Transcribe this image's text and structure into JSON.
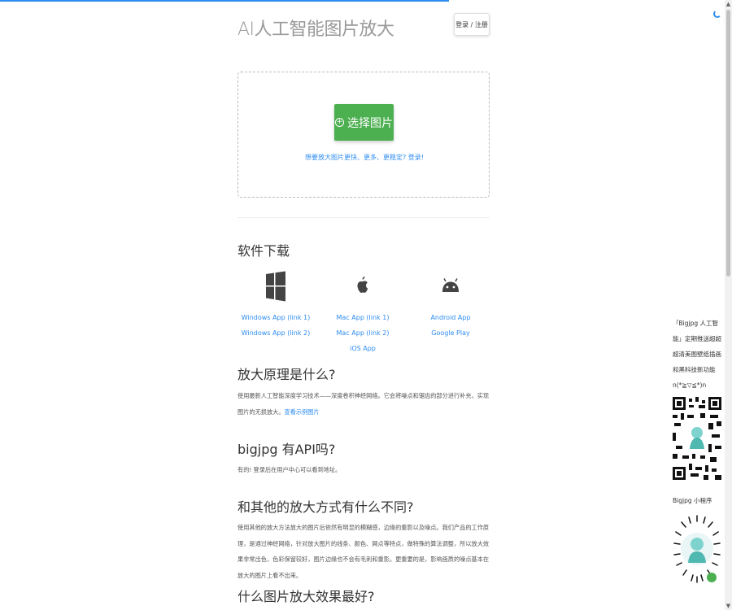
{
  "header": {
    "title": "AI人工智能图片放大",
    "login_label": "登录 / 注册"
  },
  "upload": {
    "button_label": "选择图片",
    "hint": "想要放大图片更快、更多、更稳定? 登录!"
  },
  "downloads": {
    "section_title": "软件下载",
    "platforms": [
      {
        "icon": "windows-icon",
        "links": [
          "Windows App (link 1)",
          "Windows App (link 2)"
        ]
      },
      {
        "icon": "apple-icon",
        "links": [
          "Mac App (link 1)",
          "Mac App (link 2)",
          "iOS App"
        ]
      },
      {
        "icon": "android-icon",
        "links": [
          "Android App",
          "Google Play"
        ]
      }
    ]
  },
  "faq": [
    {
      "title": "放大原理是什么?",
      "body": "使用最新人工智能深度学习技术——深度卷积神经网络。它会将噪点和锯齿的部分进行补充，实现图片的无损放大。",
      "link": "查看示例图片"
    },
    {
      "title": "bigjpg 有API吗?",
      "body": "有的! 登录后在用户中心可以看到地址。"
    },
    {
      "title": "和其他的放大方式有什么不同?",
      "body": "使用其他的放大方法放大的图片后依然有明显的模糊感，边缘的重影以及噪点。我们产品的工作原理，是通过神经网络，针对放大图片的线条、颜色、网点等特点，做特殊的算法调整，所以放大效果非常出色，色彩保留较好，图片边缘也不会有毛刺和重影。更重要的是，影响画质的噪点基本在放大的图片上看不出来。"
    },
    {
      "title": "什么图片放大效果最好?"
    }
  ],
  "sidebar": {
    "promo_text": "「Bigjpg 人工智能」定期推送超超超清美图壁纸插画和黑科技新功能 n(*≧▽≦*)n",
    "mini_program_label": "Bigjpg 小程序"
  },
  "colors": {
    "accent": "#2d8cf0",
    "upload_button": "#4caf50"
  }
}
